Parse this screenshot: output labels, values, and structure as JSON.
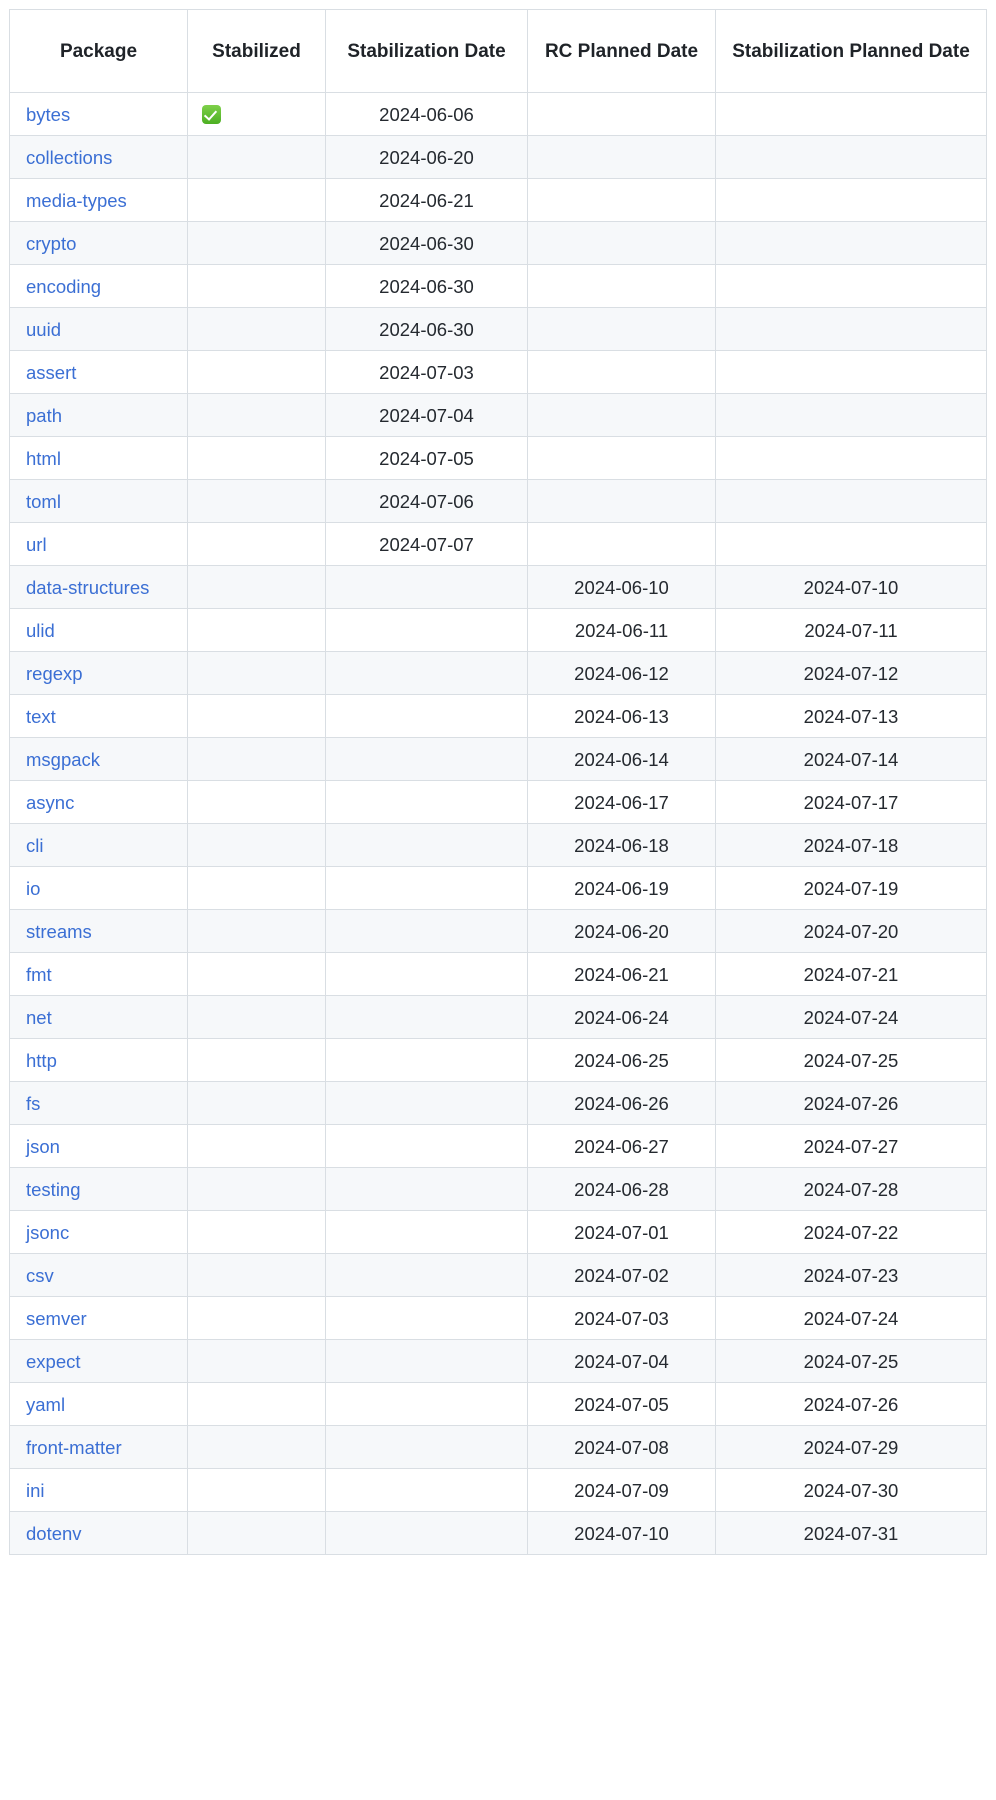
{
  "table": {
    "columns": [
      {
        "key": "package",
        "label": "Package"
      },
      {
        "key": "stabilized",
        "label": "Stabilized"
      },
      {
        "key": "stabilization_date",
        "label": "Stabilization Date"
      },
      {
        "key": "rc_planned_date",
        "label": "RC Planned Date"
      },
      {
        "key": "stab_planned_date",
        "label": "Stabilization Planned Date"
      }
    ],
    "link_color": "#3b6fd4",
    "stripe_color": "#f6f8fa",
    "border_color": "#d9dee3",
    "check_icon": "white-heavy-check-mark",
    "rows": [
      {
        "package": "bytes",
        "stabilized": "✅",
        "stabilization_date": "2024-06-06",
        "rc_planned_date": "",
        "stab_planned_date": ""
      },
      {
        "package": "collections",
        "stabilized": "",
        "stabilization_date": "2024-06-20",
        "rc_planned_date": "",
        "stab_planned_date": ""
      },
      {
        "package": "media-types",
        "stabilized": "",
        "stabilization_date": "2024-06-21",
        "rc_planned_date": "",
        "stab_planned_date": ""
      },
      {
        "package": "crypto",
        "stabilized": "",
        "stabilization_date": "2024-06-30",
        "rc_planned_date": "",
        "stab_planned_date": ""
      },
      {
        "package": "encoding",
        "stabilized": "",
        "stabilization_date": "2024-06-30",
        "rc_planned_date": "",
        "stab_planned_date": ""
      },
      {
        "package": "uuid",
        "stabilized": "",
        "stabilization_date": "2024-06-30",
        "rc_planned_date": "",
        "stab_planned_date": ""
      },
      {
        "package": "assert",
        "stabilized": "",
        "stabilization_date": "2024-07-03",
        "rc_planned_date": "",
        "stab_planned_date": ""
      },
      {
        "package": "path",
        "stabilized": "",
        "stabilization_date": "2024-07-04",
        "rc_planned_date": "",
        "stab_planned_date": ""
      },
      {
        "package": "html",
        "stabilized": "",
        "stabilization_date": "2024-07-05",
        "rc_planned_date": "",
        "stab_planned_date": ""
      },
      {
        "package": "toml",
        "stabilized": "",
        "stabilization_date": "2024-07-06",
        "rc_planned_date": "",
        "stab_planned_date": ""
      },
      {
        "package": "url",
        "stabilized": "",
        "stabilization_date": "2024-07-07",
        "rc_planned_date": "",
        "stab_planned_date": ""
      },
      {
        "package": "data-structures",
        "stabilized": "",
        "stabilization_date": "",
        "rc_planned_date": "2024-06-10",
        "stab_planned_date": "2024-07-10"
      },
      {
        "package": "ulid",
        "stabilized": "",
        "stabilization_date": "",
        "rc_planned_date": "2024-06-11",
        "stab_planned_date": "2024-07-11"
      },
      {
        "package": "regexp",
        "stabilized": "",
        "stabilization_date": "",
        "rc_planned_date": "2024-06-12",
        "stab_planned_date": "2024-07-12"
      },
      {
        "package": "text",
        "stabilized": "",
        "stabilization_date": "",
        "rc_planned_date": "2024-06-13",
        "stab_planned_date": "2024-07-13"
      },
      {
        "package": "msgpack",
        "stabilized": "",
        "stabilization_date": "",
        "rc_planned_date": "2024-06-14",
        "stab_planned_date": "2024-07-14"
      },
      {
        "package": "async",
        "stabilized": "",
        "stabilization_date": "",
        "rc_planned_date": "2024-06-17",
        "stab_planned_date": "2024-07-17"
      },
      {
        "package": "cli",
        "stabilized": "",
        "stabilization_date": "",
        "rc_planned_date": "2024-06-18",
        "stab_planned_date": "2024-07-18"
      },
      {
        "package": "io",
        "stabilized": "",
        "stabilization_date": "",
        "rc_planned_date": "2024-06-19",
        "stab_planned_date": "2024-07-19"
      },
      {
        "package": "streams",
        "stabilized": "",
        "stabilization_date": "",
        "rc_planned_date": "2024-06-20",
        "stab_planned_date": "2024-07-20"
      },
      {
        "package": "fmt",
        "stabilized": "",
        "stabilization_date": "",
        "rc_planned_date": "2024-06-21",
        "stab_planned_date": "2024-07-21"
      },
      {
        "package": "net",
        "stabilized": "",
        "stabilization_date": "",
        "rc_planned_date": "2024-06-24",
        "stab_planned_date": "2024-07-24"
      },
      {
        "package": "http",
        "stabilized": "",
        "stabilization_date": "",
        "rc_planned_date": "2024-06-25",
        "stab_planned_date": "2024-07-25"
      },
      {
        "package": "fs",
        "stabilized": "",
        "stabilization_date": "",
        "rc_planned_date": "2024-06-26",
        "stab_planned_date": "2024-07-26"
      },
      {
        "package": "json",
        "stabilized": "",
        "stabilization_date": "",
        "rc_planned_date": "2024-06-27",
        "stab_planned_date": "2024-07-27"
      },
      {
        "package": "testing",
        "stabilized": "",
        "stabilization_date": "",
        "rc_planned_date": "2024-06-28",
        "stab_planned_date": "2024-07-28"
      },
      {
        "package": "jsonc",
        "stabilized": "",
        "stabilization_date": "",
        "rc_planned_date": "2024-07-01",
        "stab_planned_date": "2024-07-22"
      },
      {
        "package": "csv",
        "stabilized": "",
        "stabilization_date": "",
        "rc_planned_date": "2024-07-02",
        "stab_planned_date": "2024-07-23"
      },
      {
        "package": "semver",
        "stabilized": "",
        "stabilization_date": "",
        "rc_planned_date": "2024-07-03",
        "stab_planned_date": "2024-07-24"
      },
      {
        "package": "expect",
        "stabilized": "",
        "stabilization_date": "",
        "rc_planned_date": "2024-07-04",
        "stab_planned_date": "2024-07-25"
      },
      {
        "package": "yaml",
        "stabilized": "",
        "stabilization_date": "",
        "rc_planned_date": "2024-07-05",
        "stab_planned_date": "2024-07-26"
      },
      {
        "package": "front-matter",
        "stabilized": "",
        "stabilization_date": "",
        "rc_planned_date": "2024-07-08",
        "stab_planned_date": "2024-07-29"
      },
      {
        "package": "ini",
        "stabilized": "",
        "stabilization_date": "",
        "rc_planned_date": "2024-07-09",
        "stab_planned_date": "2024-07-30"
      },
      {
        "package": "dotenv",
        "stabilized": "",
        "stabilization_date": "",
        "rc_planned_date": "2024-07-10",
        "stab_planned_date": "2024-07-31"
      }
    ]
  }
}
